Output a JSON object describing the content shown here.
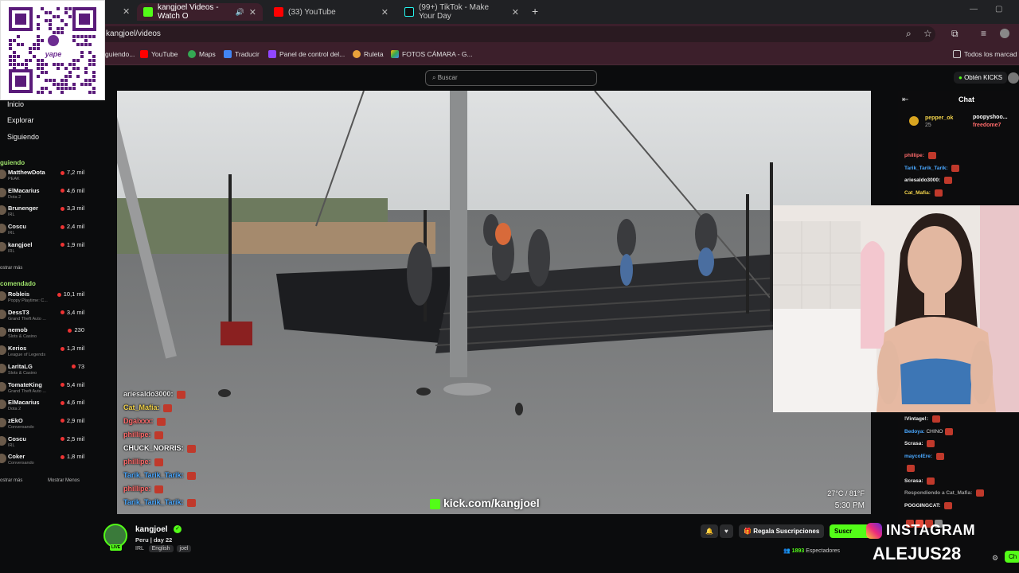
{
  "browser": {
    "tabs": [
      {
        "label": "kangjoel Videos - Watch O",
        "active": true,
        "icon": "kick-icon"
      },
      {
        "label": "(33) YouTube",
        "active": false,
        "icon": "youtube-icon"
      },
      {
        "label": "(99+) TikTok - Make Your Day",
        "active": false,
        "icon": "tiktok-icon"
      }
    ],
    "url": "kangjoel/videos",
    "bookmarks": [
      "guiendo...",
      "YouTube",
      "Maps",
      "Traducir",
      "Panel de control del...",
      "Ruleta",
      "FOTOS CÁMARA - G...",
      "Todos los marcad"
    ]
  },
  "site": {
    "search_placeholder": "Buscar",
    "get_kicks": "Obtén KICKS"
  },
  "sidebar": {
    "nav": [
      "Inicio",
      "Explorar",
      "Siguiendo"
    ],
    "following_title": "guiendo",
    "following": [
      {
        "name": "MatthewDota",
        "sub": "PEAK",
        "viewers": "7,2 mil"
      },
      {
        "name": "ElMacarius",
        "sub": "Dota 2",
        "viewers": "4,6 mil"
      },
      {
        "name": "Brunenger",
        "sub": "IRL",
        "viewers": "3,3 mil"
      },
      {
        "name": "Coscu",
        "sub": "IRL",
        "viewers": "2,4 mil"
      },
      {
        "name": "kangjoel",
        "sub": "IRL",
        "viewers": "1,9 mil"
      }
    ],
    "show_more_1": "ostrar más",
    "recommended_title": "comendado",
    "recommended": [
      {
        "name": "Robleis",
        "sub": "Poppy Playtime: C...",
        "viewers": "10,1 mil"
      },
      {
        "name": "DessT3",
        "sub": "Grand Theft Auto ...",
        "viewers": "3,4 mil"
      },
      {
        "name": "nemob",
        "sub": "Slots & Casino",
        "viewers": "230"
      },
      {
        "name": "Kerios",
        "sub": "League of Legends",
        "viewers": "1,3 mil"
      },
      {
        "name": "LaritaLG",
        "sub": "Slots & Casino",
        "viewers": "73"
      },
      {
        "name": "TomateKing",
        "sub": "Grand Theft Auto ...",
        "viewers": "5,4 mil"
      },
      {
        "name": "ElMacarius",
        "sub": "Dota 2",
        "viewers": "4,6 mil"
      },
      {
        "name": "zEkO",
        "sub": "Conversando",
        "viewers": "2,9 mil"
      },
      {
        "name": "Coscu",
        "sub": "IRL",
        "viewers": "2,5 mil"
      },
      {
        "name": "Coker",
        "sub": "Conversando",
        "viewers": "1,8 mil"
      }
    ],
    "show_more_2": "ostrar más",
    "show_less": "Mostrar Menos"
  },
  "qr": {
    "brand": "yape"
  },
  "video": {
    "watermark": "kick.com/kangjoel",
    "weather": "27°C / 81°F",
    "time": "5:30 PM",
    "overlay_chat": [
      {
        "user": "ariesaldo3000:",
        "text": "",
        "color": "#e8e8e8"
      },
      {
        "user": "Cat_Mafia:",
        "text": "",
        "color": "#f2d34b"
      },
      {
        "user": "Dgaixxx:",
        "text": "",
        "color": "#ff6b6b"
      },
      {
        "user": "phillipe:",
        "text": "",
        "color": "#ff6b6b"
      },
      {
        "user": "CHUCK_NORRIS:",
        "text": "",
        "color": "#ffffff"
      },
      {
        "user": "phillipe:",
        "text": "",
        "color": "#ff6b6b"
      },
      {
        "user": "Tarik_Tarik_Tarik:",
        "text": "",
        "color": "#4aa8ff"
      },
      {
        "user": "phillipe:",
        "text": "",
        "color": "#ff6b6b"
      },
      {
        "user": "Tarik_Tarik_Tarik:",
        "text": "",
        "color": "#4aa8ff"
      }
    ]
  },
  "chat": {
    "title": "Chat",
    "pinned": [
      {
        "user": "pepper_ok",
        "count": "25"
      },
      {
        "user": "poopyshoo...",
        "count": "20"
      },
      {
        "user": "freedome7",
        "count": "20"
      }
    ],
    "messages_top": [
      {
        "user": "phillipe:",
        "color": "#ff6b6b",
        "text": ""
      },
      {
        "user": "Tarik_Tarik_Tarik:",
        "color": "#4aa8ff",
        "text": ""
      },
      {
        "user": "ariesaldo3000:",
        "color": "#f0f0f0",
        "text": ""
      },
      {
        "user": "Cat_Mafia:",
        "color": "#f2d34b",
        "text": ""
      }
    ],
    "messages_bottom": [
      {
        "user": "!Vintage!:",
        "color": "#f0f0f0",
        "text": ""
      },
      {
        "user": "Bedoya:",
        "color": "#4aa8ff",
        "text": "CHINO"
      },
      {
        "user": "Scrasa:",
        "color": "#f0f0f0",
        "text": ""
      },
      {
        "user": "maycolEre:",
        "color": "#4aa8ff",
        "text": ""
      },
      {
        "user": "",
        "color": "#f0f0f0",
        "text": ""
      },
      {
        "user": "Scrasa:",
        "color": "#f0f0f0",
        "text": ""
      },
      {
        "user": "Respondiendo a Cat_Mafia:",
        "color": "#9a9a9a",
        "text": ""
      },
      {
        "user": "POGGINGCAT:",
        "color": "#f0f0f0",
        "text": ""
      }
    ]
  },
  "stream": {
    "name": "kangjoel",
    "title": "Peru | day 22",
    "tags": [
      "IRL",
      "English",
      "joel"
    ],
    "live_badge": "LIVE",
    "gift_subs": "Regala Suscripciones",
    "subscribe": "Suscr",
    "viewers": "1893",
    "viewers_label": "Espectadores",
    "instagram_label": "INSTAGRAM",
    "instagram_handle": "ALEJUS28"
  }
}
